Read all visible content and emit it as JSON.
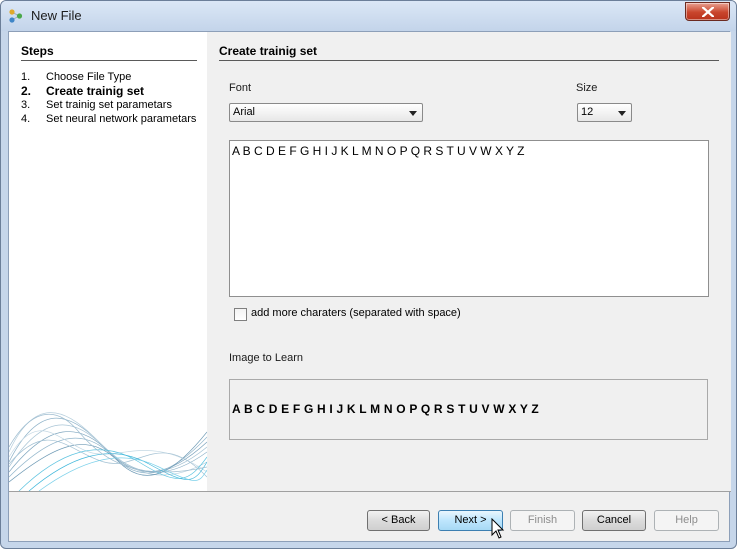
{
  "window": {
    "title": "New File"
  },
  "steps": {
    "title": "Steps",
    "items": [
      {
        "num": "1.",
        "label": "Choose File Type",
        "active": false
      },
      {
        "num": "2.",
        "label": "Create trainig set",
        "active": true
      },
      {
        "num": "3.",
        "label": "Set trainig set parametars",
        "active": false
      },
      {
        "num": "4.",
        "label": "Set neural network parametars",
        "active": false
      }
    ]
  },
  "main": {
    "title": "Create trainig set",
    "font": {
      "label": "Font",
      "value": "Arial"
    },
    "size": {
      "label": "Size",
      "value": "12"
    },
    "characters": "A B C D E F G H I J K L M N O P Q R S T U V W X Y Z",
    "more_chars_label": "add more charaters (separated with space)",
    "more_chars_checked": false,
    "image_label": "Image to Learn",
    "image_text": "A B C D E F G H I J K L M N O P Q R S T U V W X Y Z"
  },
  "buttons": {
    "back": "< Back",
    "next": "Next >",
    "finish": "Finish",
    "cancel": "Cancel",
    "help": "Help"
  }
}
